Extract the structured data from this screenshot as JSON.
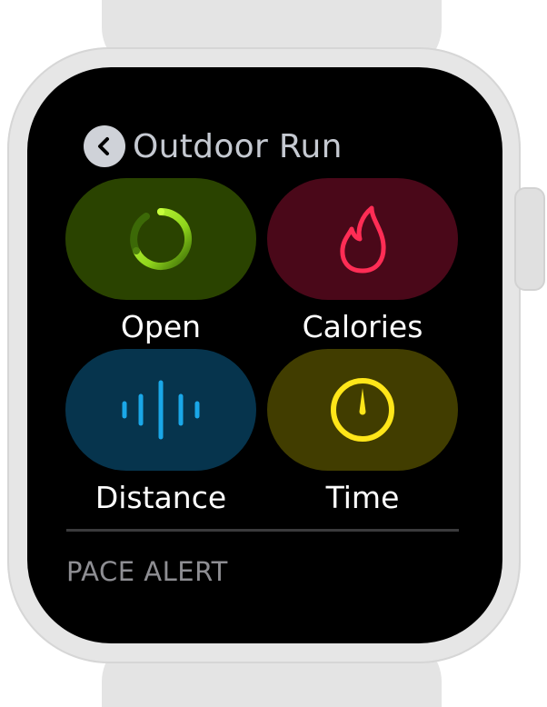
{
  "header": {
    "title": "Outdoor Run"
  },
  "tiles": [
    {
      "label": "Open",
      "icon": "open-goal-ring-icon",
      "color": "#9ee02a",
      "background": "#2a4300"
    },
    {
      "label": "Calories",
      "icon": "flame-icon",
      "color": "#ff2d55",
      "background": "#4a0819"
    },
    {
      "label": "Distance",
      "icon": "distance-bars-icon",
      "color": "#1aa7e8",
      "background": "#06344d"
    },
    {
      "label": "Time",
      "icon": "stopwatch-icon",
      "color": "#ffe619",
      "background": "#413d00"
    }
  ],
  "section": {
    "label": "PACE ALERT"
  },
  "colors": {
    "screen": "#000000",
    "case": "#e6e6e6",
    "back_button": "#cfd2d8"
  }
}
